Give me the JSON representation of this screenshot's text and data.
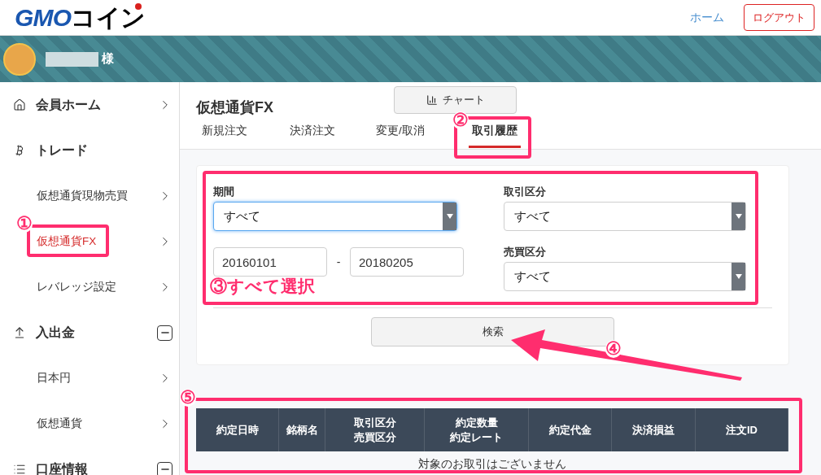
{
  "header": {
    "logo": [
      "GMO",
      "コイン"
    ],
    "links": [
      {
        "label": "ホーム",
        "kind": "link"
      },
      {
        "label": "ログアウト",
        "kind": "outlined"
      }
    ]
  },
  "user": {
    "suffix": "様"
  },
  "sidebar": {
    "sections": [
      {
        "label": "会員ホーム",
        "kind": "link"
      },
      {
        "label": "トレード",
        "kind": "group",
        "children": [
          {
            "label": "仮想通貨現物売買",
            "selected": false
          },
          {
            "label": "仮想通貨FX",
            "selected": true
          },
          {
            "label": "レバレッジ設定",
            "selected": false
          }
        ]
      },
      {
        "label": "入出金",
        "kind": "toggle",
        "expanded": true,
        "children": [
          {
            "label": "日本円",
            "selected": false
          },
          {
            "label": "仮想通貨",
            "selected": false
          }
        ]
      },
      {
        "label": "口座情報",
        "kind": "toggle",
        "expanded": true
      }
    ]
  },
  "page": {
    "title": "仮想通貨FX",
    "chart_button": "チャート",
    "tabs": [
      {
        "label": "新規注文",
        "selected": false
      },
      {
        "label": "決済注文",
        "selected": false
      },
      {
        "label": "変更/取消",
        "selected": false
      },
      {
        "label": "取引履歴",
        "selected": true
      }
    ]
  },
  "form": {
    "period": {
      "label": "期間",
      "value": "すべて",
      "focused": true
    },
    "date_from": "20160101",
    "separator": "-",
    "date_to": "20180205",
    "trade_type": {
      "label": "取引区分",
      "value": "すべて",
      "focused": false
    },
    "side": {
      "label": "売買区分",
      "value": "すべて",
      "focused": false
    },
    "search_button": "検索"
  },
  "table": {
    "columns": [
      [
        "約定日時"
      ],
      [
        "銘柄名"
      ],
      [
        "取引区分",
        "売買区分"
      ],
      [
        "約定数量",
        "約定レート"
      ],
      [
        "約定代金"
      ],
      [
        "決済損益"
      ],
      [
        "注文ID"
      ]
    ],
    "empty_message": "対象のお取引はございません"
  },
  "annotations": {
    "markers": [
      "①",
      "②",
      "④",
      "⑤"
    ],
    "note": "③すべて選択"
  }
}
